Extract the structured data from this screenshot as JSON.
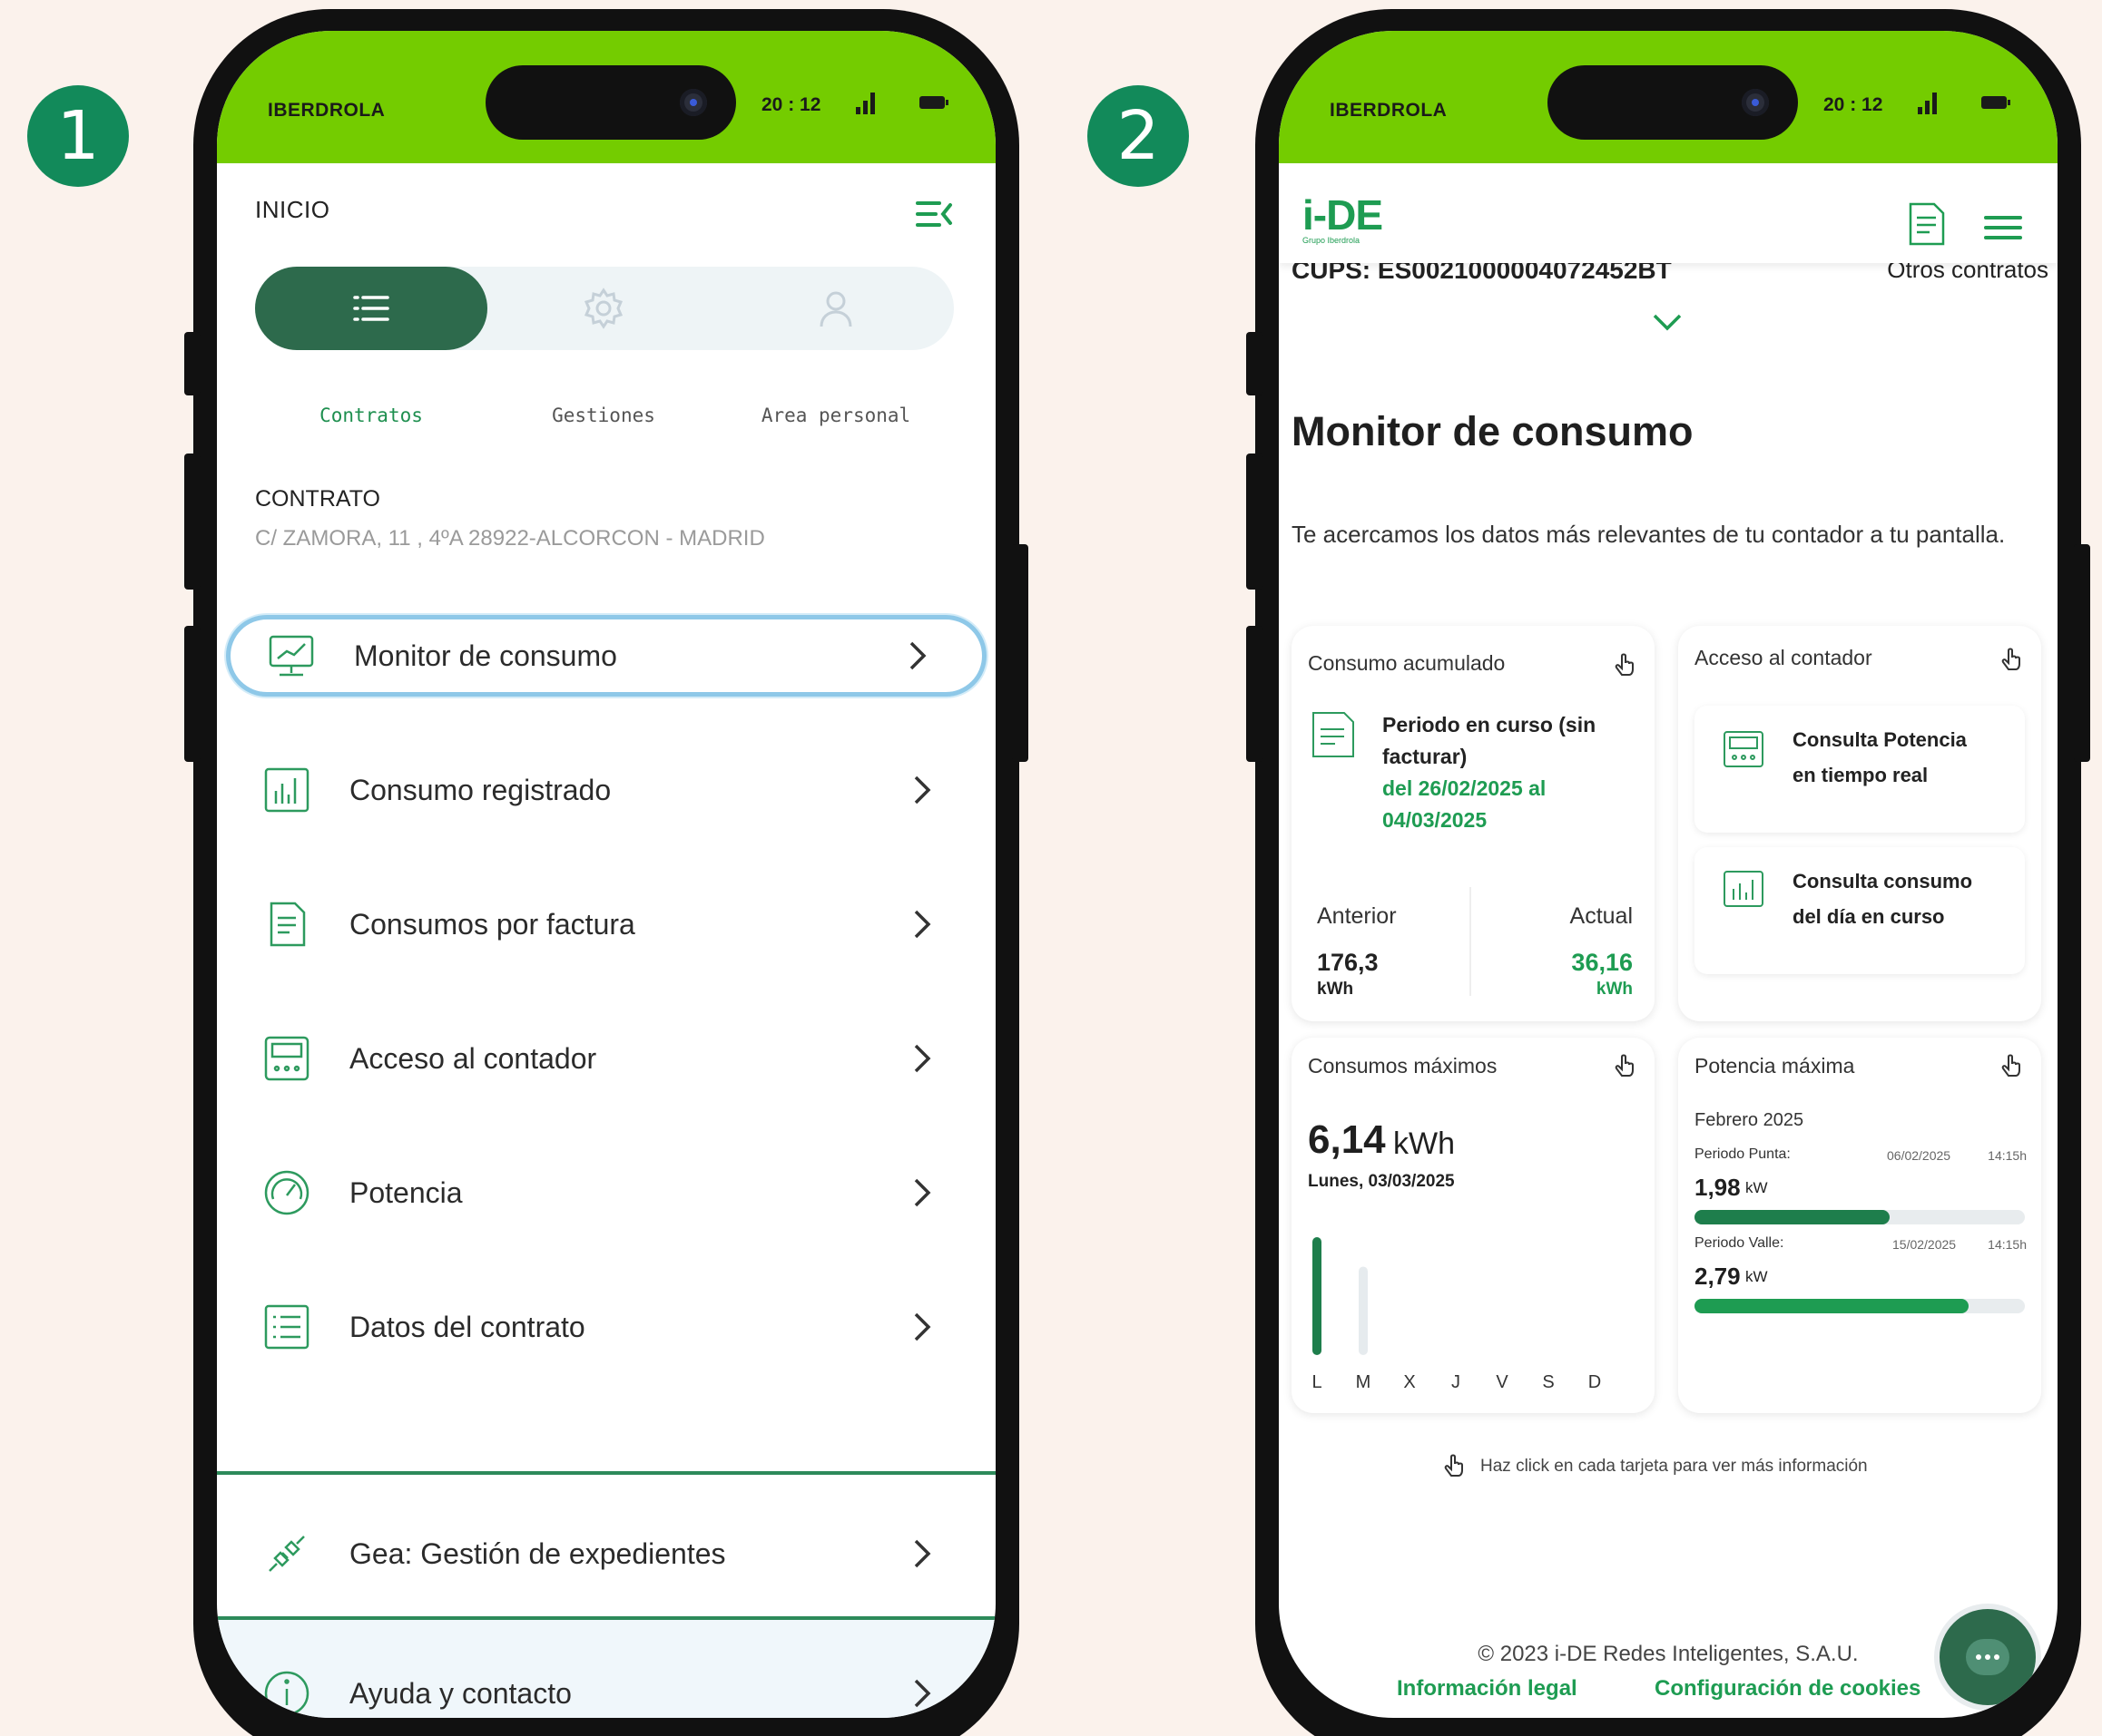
{
  "steps": [
    "1",
    "2"
  ],
  "status_bar": {
    "carrier": "IBERDROLA",
    "time": "20 : 12"
  },
  "phone1": {
    "header_title": "INICIO",
    "tabs": [
      {
        "label": "Contratos",
        "icon": "list-icon",
        "active": true
      },
      {
        "label": "Gestiones",
        "icon": "gear-icon",
        "active": false
      },
      {
        "label": "Area personal",
        "icon": "user-icon",
        "active": false
      }
    ],
    "contract": {
      "heading": "CONTRATO",
      "address": "C/ ZAMORA, 11 , 4ºA 28922-ALCORCON - MADRID"
    },
    "menu": [
      {
        "label": "Monitor de consumo",
        "icon": "monitor-icon",
        "selected": true
      },
      {
        "label": "Consumo registrado",
        "icon": "bar-chart-icon"
      },
      {
        "label": "Consumos por factura",
        "icon": "invoice-icon"
      },
      {
        "label": "Acceso al contador",
        "icon": "meter-icon"
      },
      {
        "label": "Potencia",
        "icon": "gauge-icon"
      },
      {
        "label": "Datos del contrato",
        "icon": "list-doc-icon"
      }
    ],
    "extra": [
      {
        "label": "Gea: Gestión de expedientes",
        "icon": "plug-icon"
      },
      {
        "label": "Ayuda y contacto",
        "icon": "info-icon"
      }
    ]
  },
  "phone2": {
    "logo": {
      "text": "i-DE",
      "sub": "Grupo Iberdrola"
    },
    "cups": "CUPS: ES0021000004072452BT",
    "other_contracts": "Otros contratos",
    "title": "Monitor de consumo",
    "intro": "Te acercamos los datos más relevantes de tu contador a tu pantalla.",
    "consumo_acumulado": {
      "title": "Consumo acumulado",
      "period_label": "Periodo en curso (sin facturar)",
      "period_dates": "del 26/02/2025 al 04/03/2025",
      "anterior_label": "Anterior",
      "anterior_value": "176,3",
      "anterior_unit": "kWh",
      "actual_label": "Actual",
      "actual_value": "36,16",
      "actual_unit": "kWh"
    },
    "acceso_contador": {
      "title": "Acceso al contador",
      "option1": "Consulta Potencia en tiempo real",
      "option2": "Consulta consumo del día en curso"
    },
    "consumos_maximos": {
      "title": "Consumos máximos",
      "value": "6,14",
      "unit": "kWh",
      "date": "Lunes, 03/03/2025",
      "days": [
        "L",
        "M",
        "X",
        "J",
        "V",
        "S",
        "D"
      ],
      "bars": [
        {
          "day": "L",
          "value": 1.0
        },
        {
          "day": "M",
          "value": 0.75
        }
      ]
    },
    "potencia_maxima": {
      "title": "Potencia máxima",
      "month": "Febrero 2025",
      "punta_label": "Periodo Punta:",
      "punta_date": "06/02/2025",
      "punta_time": "14:15h",
      "punta_value": "1,98",
      "punta_unit": "kW",
      "punta_fraction": 0.59,
      "valle_label": "Periodo Valle:",
      "valle_date": "15/02/2025",
      "valle_time": "14:15h",
      "valle_value": "2,79",
      "valle_unit": "kW",
      "valle_fraction": 0.83
    },
    "hint": "Haz click en cada tarjeta para ver más información",
    "copyright": "© 2023 i-DE Redes Inteligentes, S.A.U.",
    "legal_link": "Información legal",
    "cookies_link": "Configuración de cookies"
  },
  "colors": {
    "status_green": "#74cc00",
    "brand_dark_green": "#2d6a4c",
    "accent_green": "#1e9c52",
    "selected_border": "#8ec8e8",
    "background": "#fbf2ec"
  }
}
